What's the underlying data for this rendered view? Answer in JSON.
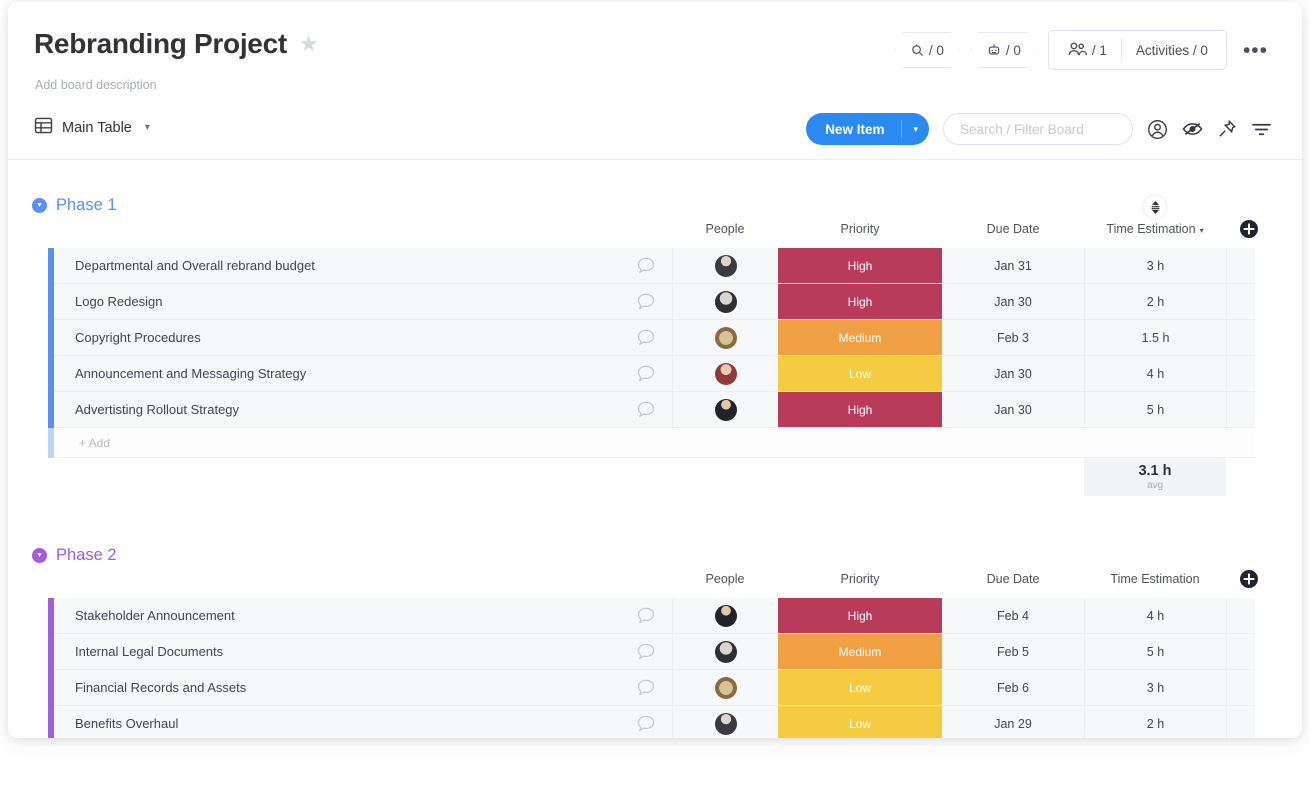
{
  "header": {
    "title": "Rebranding Project",
    "description": "Add board description",
    "star_icon": "star-icon",
    "pills": [
      {
        "icon": "search-activity-icon",
        "value": "/ 0"
      },
      {
        "icon": "automation-robot-icon",
        "value": "/ 0"
      }
    ],
    "members": {
      "icon": "people-icon",
      "value": "/ 1"
    },
    "activities": "Activities / 0",
    "more_menu": "•••"
  },
  "toolbar": {
    "tab_icon": "table-icon",
    "tab_label": "Main Table",
    "tab_chevron": "▾",
    "new_item_label": "New Item",
    "new_item_arrow": "▾",
    "search_placeholder": "Search / Filter Board",
    "icons": [
      "person-circle-icon",
      "hide-eye-icon",
      "pin-icon",
      "filter-icon"
    ]
  },
  "columns": [
    "People",
    "Priority",
    "Due Date",
    "Time Estimation"
  ],
  "add_column_icon": "plus-circle-icon",
  "sort_icon": "sort-updown-icon",
  "column_dropdown_icon": "▾",
  "colors": {
    "accent_blue": "#2b8aef",
    "phase1": "#5b8ff0",
    "phase2": "#a25ddc",
    "high": "#b93b5a",
    "medium": "#f0a043",
    "low": "#f5cb42"
  },
  "groups": [
    {
      "name": "Phase 1",
      "color": "#5b8ff0",
      "row_accent": "#5b8ff0",
      "add_accent": "#bed3f8",
      "has_sort_toggle": true,
      "has_column_dropdown": true,
      "add_label": "+ Add",
      "items": [
        {
          "name": "Departmental and Overall rebrand budget",
          "avatar": "avatar-woman-dark",
          "priority": "High",
          "priority_color": "#b93b5a",
          "due": "Jan 31",
          "time": "3 h"
        },
        {
          "name": "Logo Redesign",
          "avatar": "avatar-man-bw",
          "priority": "High",
          "priority_color": "#b93b5a",
          "due": "Jan 30",
          "time": "2 h"
        },
        {
          "name": "Copyright Procedures",
          "avatar": "avatar-dog",
          "priority": "Medium",
          "priority_color": "#f0a043",
          "due": "Feb 3",
          "time": "1.5 h"
        },
        {
          "name": "Announcement and Messaging Strategy",
          "avatar": "avatar-woman-red",
          "priority": "Low",
          "priority_color": "#f5cb42",
          "due": "Jan 30",
          "time": "4 h"
        },
        {
          "name": "Advertisting Rollout Strategy",
          "avatar": "avatar-man-suit",
          "priority": "High",
          "priority_color": "#b93b5a",
          "due": "Jan 30",
          "time": "5 h"
        }
      ],
      "summary": {
        "value": "3.1 h",
        "label": "avg"
      }
    },
    {
      "name": "Phase 2",
      "color": "#a25ddc",
      "row_accent": "#a25ddc",
      "has_sort_toggle": false,
      "has_column_dropdown": false,
      "items": [
        {
          "name": "Stakeholder Announcement",
          "avatar": "avatar-man-suit",
          "priority": "High",
          "priority_color": "#b93b5a",
          "due": "Feb 4",
          "time": "4 h"
        },
        {
          "name": "Internal Legal Documents",
          "avatar": "avatar-man-bw",
          "priority": "Medium",
          "priority_color": "#f0a043",
          "due": "Feb 5",
          "time": "5 h"
        },
        {
          "name": "Financial Records and Assets",
          "avatar": "avatar-dog",
          "priority": "Low",
          "priority_color": "#f5cb42",
          "due": "Feb 6",
          "time": "3 h"
        },
        {
          "name": "Benefits Overhaul",
          "avatar": "avatar-woman-dark",
          "priority": "Low",
          "priority_color": "#f5cb42",
          "due": "Jan 29",
          "time": "2 h"
        }
      ]
    }
  ]
}
